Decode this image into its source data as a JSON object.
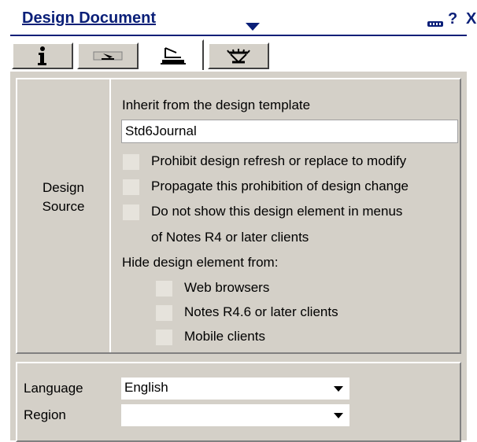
{
  "window": {
    "title": "Design Document",
    "controls": {
      "help": "?",
      "close": "X"
    }
  },
  "tabs": [
    {
      "name": "info",
      "icon": "info-icon",
      "glyph": "i"
    },
    {
      "name": "launch",
      "icon": "launch-icon"
    },
    {
      "name": "design",
      "icon": "design-icon",
      "active": true
    },
    {
      "name": "security",
      "icon": "key-icon"
    }
  ],
  "design_source": {
    "section_label": "Design\nSource",
    "inherit_label": "Inherit from the design template",
    "template_value": "Std6Journal",
    "options": [
      {
        "label": "Prohibit design refresh or replace to modify",
        "checked": false
      },
      {
        "label": "Propagate this prohibition of design change",
        "checked": false
      },
      {
        "label": "Do not show this design element in menus",
        "checked": false
      }
    ],
    "option_continuation": "of Notes R4 or later clients",
    "hide_label": "Hide design element from:",
    "hide_options": [
      {
        "label": "Web browsers",
        "checked": false
      },
      {
        "label": "Notes R4.6 or later clients",
        "checked": false
      },
      {
        "label": "Mobile clients",
        "checked": false
      }
    ]
  },
  "locale": {
    "language_label": "Language",
    "language_value": "English",
    "region_label": "Region",
    "region_value": ""
  }
}
